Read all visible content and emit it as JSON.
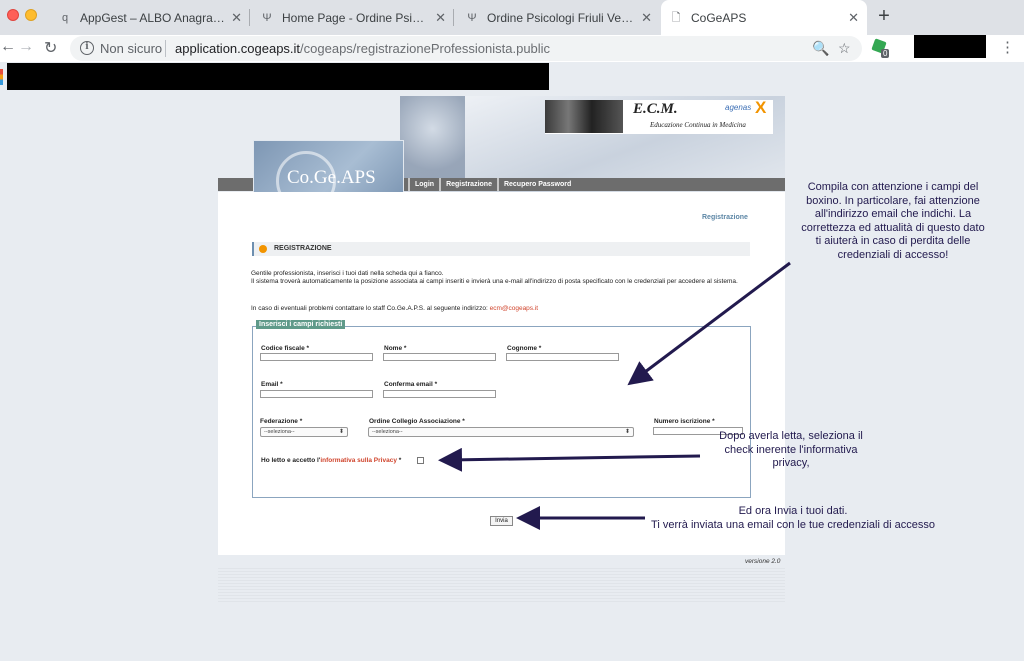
{
  "browser": {
    "tabs": [
      {
        "title": "AppGest – ALBO Anagrafico",
        "favicon": "q"
      },
      {
        "title": "Home Page - Ordine Psicologi",
        "favicon": "psi"
      },
      {
        "title": "Ordine Psicologi Friuli Venezia",
        "favicon": "psi"
      },
      {
        "title": "CoGeAPS",
        "favicon": "doc"
      }
    ],
    "address": {
      "security_label": "Non sicuro",
      "host": "application.cogeaps.it",
      "path": "/cogeaps/registrazioneProfessionista.public"
    },
    "extension_badge": "0"
  },
  "site": {
    "logo_text": "Co.Ge.APS",
    "ecm_title": "E.C.M.",
    "ecm_subtitle": "Educazione Continua in Medicina",
    "agenas": "agenas",
    "nav": [
      "Login",
      "Registrazione",
      "Recupero Password"
    ],
    "breadcrumb": "Registrazione",
    "section_title": "REGISTRAZIONE",
    "intro_line1": "Gentile professionista, inserisci i tuoi dati nella scheda qui a fianco.",
    "intro_line2": "Il sistema troverà automaticamente la posizione associata ai campi inseriti e invierà una e-mail all'indirizzo di posta specificato con le credenziali per accedere al sistema.",
    "contact_text": "In caso di eventuali problemi contattare lo staff Co.Ge.A.P.S. al seguente indirizzo: ",
    "contact_email": "ecm@cogeaps.it",
    "version": "versione 2.0"
  },
  "form": {
    "legend": "Inserisci i campi richiesti",
    "codice_fiscale": "Codice fiscale *",
    "nome": "Nome *",
    "cognome": "Cognome *",
    "email": "Email *",
    "conferma_email": "Conferma email *",
    "federazione": "Federazione *",
    "federazione_value": "--seleziona--",
    "ordine": "Ordine Collegio Associazione *",
    "ordine_value": "--seleziona--",
    "numero_iscrizione": "Numero iscrizione *",
    "privacy_prefix": "Ho letto e accetto l'",
    "privacy_link": "informativa sulla Privacy",
    "privacy_suffix": " *",
    "submit": "Invia"
  },
  "annotations": {
    "note1": "Compila con attenzione i campi del boxino. In particolare, fai attenzione all'indirizzo email che indichi. La correttezza ed attualità di questo dato ti aiuterà in caso di perdita delle credenziali di accesso!",
    "note2": "Dopo averla letta, seleziona il check inerente l'informativa privacy,",
    "note3_line1": "Ed ora Invia i tuoi dati.",
    "note3_line2": "Ti verrà inviata una email con le tue credenziali di accesso"
  },
  "colors": {
    "accent_orange": "#f29400",
    "link_red": "#d0442c",
    "annotation": "#221a4e",
    "legend_bg": "#5f9a8a"
  }
}
